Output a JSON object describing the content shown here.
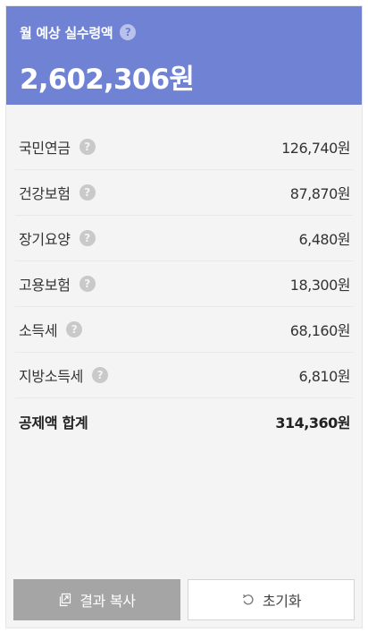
{
  "header": {
    "title": "월 예상 실수령액",
    "help_glyph": "?",
    "amount": "2,602,306원"
  },
  "deductions": [
    {
      "label": "국민연금",
      "value": "126,740원",
      "help_glyph": "?"
    },
    {
      "label": "건강보험",
      "value": "87,870원",
      "help_glyph": "?"
    },
    {
      "label": "장기요양",
      "value": "6,480원",
      "help_glyph": "?"
    },
    {
      "label": "고용보험",
      "value": "18,300원",
      "help_glyph": "?"
    },
    {
      "label": "소득세",
      "value": "68,160원",
      "help_glyph": "?"
    },
    {
      "label": "지방소득세",
      "value": "6,810원",
      "help_glyph": "?"
    }
  ],
  "total": {
    "label": "공제액 합계",
    "value": "314,360원"
  },
  "buttons": {
    "copy_label": "결과 복사",
    "copy_icon": "copy-icon",
    "reset_label": "초기화",
    "reset_icon": "reset-icon"
  },
  "colors": {
    "header_bg": "#6f82d4",
    "copy_button_bg": "#a5a5a5",
    "panel_bg": "#f4f4f4"
  }
}
